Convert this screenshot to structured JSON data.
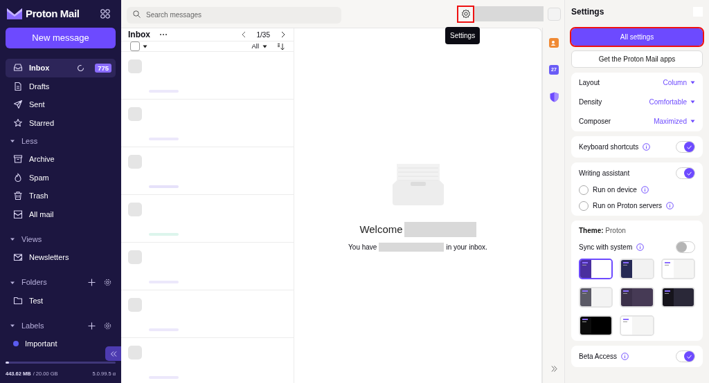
{
  "sidebar": {
    "brand": "Proton Mail",
    "new_message": "New message",
    "sections": [
      {
        "kind": "plain",
        "items": [
          {
            "label": "Inbox",
            "selected": true,
            "count": "775"
          },
          {
            "label": "Drafts",
            "selected": false
          },
          {
            "label": "Sent",
            "selected": false
          },
          {
            "label": "Starred",
            "selected": false
          }
        ]
      },
      {
        "kind": "group",
        "title": "Less",
        "expanded": true,
        "items": [
          {
            "label": "Archive",
            "selected": false
          },
          {
            "label": "Spam",
            "selected": false
          },
          {
            "label": "Trash",
            "selected": false
          },
          {
            "label": "All mail",
            "selected": false
          }
        ]
      },
      {
        "kind": "group",
        "title": "Views",
        "expanded": true,
        "items": [
          {
            "label": "Newsletters",
            "selected": false
          }
        ]
      },
      {
        "kind": "folders",
        "title": "Folders",
        "expanded": true,
        "items": [
          {
            "label": "Test",
            "selected": false
          }
        ]
      },
      {
        "kind": "labels",
        "title": "Labels",
        "expanded": true,
        "items": [
          {
            "label": "Important",
            "selected": false,
            "color": "#5b5cf0"
          }
        ]
      }
    ],
    "storage": {
      "used": "443.62 MB",
      "total": "/ 20.00 GB",
      "level": 0.03
    },
    "version": "5.0.99.5 α"
  },
  "topbar": {
    "search": {
      "placeholder": "Search messages"
    },
    "settings_tooltip": "Settings",
    "settings_highlighted": true
  },
  "list": {
    "title": "Inbox",
    "pagination": "1/35",
    "filter": "All",
    "select_all": {
      "checked": false
    },
    "rows": [
      {
        "color": "#ece8fb"
      },
      {
        "color": "#ece8fb"
      },
      {
        "color": "#e6e1fa"
      },
      {
        "color": "#dcf5ec"
      },
      {
        "color": "#ece8fb"
      },
      {
        "color": "#ece8fb"
      },
      {
        "color": "#ece8fb"
      }
    ]
  },
  "reading_pane": {
    "welcome": "Welcome",
    "inbox_before": "You have",
    "inbox_after": "in your inbox."
  },
  "apps_rail": {
    "calendar_day": "27"
  },
  "settings": {
    "title": "Settings",
    "buttons": [
      {
        "label": "All settings",
        "kind": "primary",
        "highlighted": true
      },
      {
        "label": "Get the Proton Mail apps",
        "kind": "secondary",
        "highlighted": false
      }
    ],
    "dropdowns": [
      {
        "label": "Layout",
        "value": "Column"
      },
      {
        "label": "Density",
        "value": "Comfortable"
      },
      {
        "label": "Composer",
        "value": "Maximized"
      }
    ],
    "keyboard_shortcuts": {
      "label": "Keyboard shortcuts",
      "on": true
    },
    "writing_assistant": {
      "label": "Writing assistant",
      "on": true,
      "options": [
        {
          "label": "Run on device",
          "selected": false
        },
        {
          "label": "Run on Proton servers",
          "selected": false
        }
      ]
    },
    "theme": {
      "heading": "**Theme:** Proton",
      "sync": {
        "label": "Sync with system",
        "on": false
      },
      "themes": [
        {
          "sidebar": {
            "color": "#4a2f9e"
          },
          "content": {
            "color": "#ffffff"
          },
          "selected": true
        },
        {
          "sidebar": {
            "color": "#262a55"
          },
          "content": {
            "color": "#f2f2f2"
          },
          "selected": false
        },
        {
          "sidebar": {
            "color": "#ffffff"
          },
          "content": {
            "color": "#f5f5f4"
          },
          "selected": false
        },
        {
          "sidebar": {
            "color": "#5b5a66"
          },
          "content": {
            "color": "#f3f3f3"
          },
          "selected": false
        },
        {
          "sidebar": {
            "color": "#3b3049"
          },
          "content": {
            "color": "#463a55"
          },
          "selected": false
        },
        {
          "sidebar": {
            "color": "#16141c"
          },
          "content": {
            "color": "#2a2838"
          },
          "selected": false
        },
        {
          "sidebar": {
            "color": "#0c0c0c"
          },
          "content": {
            "color": "#000000"
          },
          "selected": false
        },
        {
          "sidebar": {
            "color": "#ffffff"
          },
          "content": {
            "color": "#f5f5f4"
          },
          "selected": false
        }
      ]
    },
    "beta_access": {
      "label": "Beta Access",
      "on": true
    }
  }
}
